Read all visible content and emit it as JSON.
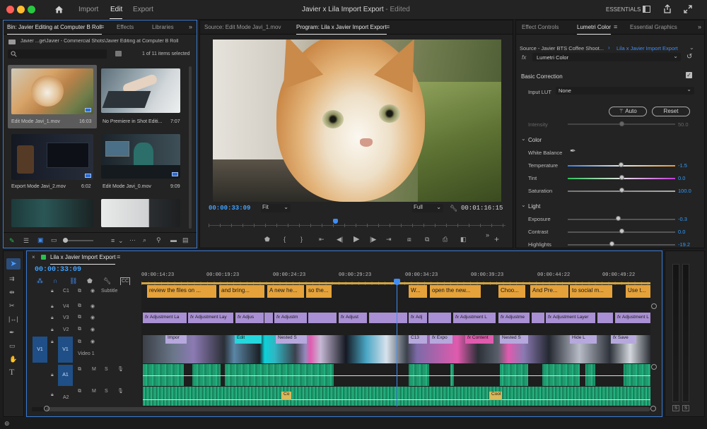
{
  "titlebar": {
    "workspaces": [
      "Import",
      "Edit",
      "Export"
    ],
    "active_workspace": "Edit",
    "project_title": "Javier x Lila Import Export",
    "edited_label": "- Edited",
    "essentials_label": "ESSENTIALS"
  },
  "project_panel": {
    "tabs": [
      "Bin: Javier Editing at Computer B Roll",
      "Effects",
      "Libraries"
    ],
    "path": "Javier ...ge\\Javier - Commercial Shots\\Javier Editing at Computer B Roll",
    "selection_info": "1 of 11 items selected",
    "items": [
      {
        "name": "Edit Mode Javi_1.mov",
        "duration": "16:03"
      },
      {
        "name": "No Premiere in Shot Editi...",
        "duration": "7:07"
      },
      {
        "name": "Export Mode Javi_2.mov",
        "duration": "6:02"
      },
      {
        "name": "Edit Mode Javi_0.mov",
        "duration": "9:09"
      }
    ]
  },
  "monitor": {
    "tabs": [
      "Source: Edit Mode Javi_1.mov",
      "Program: Lila x Javier Import Export"
    ],
    "timecode_current": "00:00:33:09",
    "timecode_duration": "00:01:16:15",
    "zoom": "Fit",
    "resolution": "Full"
  },
  "lumetri": {
    "tabs": [
      "Effect Controls",
      "Lumetri Color",
      "Essential Graphics"
    ],
    "source_label": "Source - Javier BTS Coffee Shoot...",
    "sequence_label": "Lila x Javier Import Export",
    "fx_label": "Lumetri Color",
    "basic_correction": "Basic Correction",
    "input_lut_label": "Input LUT",
    "input_lut_value": "None",
    "auto_label": "Auto",
    "reset_label": "Reset",
    "intensity_label": "Intensity",
    "intensity_value": "50.0",
    "color_section": "Color",
    "white_balance": "White Balance",
    "temperature_label": "Temperature",
    "temperature_value": "-1.5",
    "tint_label": "Tint",
    "tint_value": "0.0",
    "saturation_label": "Saturation",
    "saturation_value": "100.0",
    "light_section": "Light",
    "exposure_label": "Exposure",
    "exposure_value": "-0.3",
    "contrast_label": "Contrast",
    "contrast_value": "0.0",
    "highlights_label": "Highlights",
    "highlights_value": "-19.2"
  },
  "timeline": {
    "title": "Lila x Javier Import Export",
    "timecode": "00:00:33:09",
    "ruler": [
      "00:00:14:23",
      "00:00:19:23",
      "00:00:24:23",
      "00:00:29:23",
      "00:00:34:23",
      "00:00:39:23",
      "00:00:44:22",
      "00:00:49:22"
    ],
    "tracks": {
      "c1": "C1",
      "subtitle": "Subtitle",
      "v4": "V4",
      "v3": "V3",
      "v2": "V2",
      "v1": "V1",
      "video1": "Video 1",
      "a1": "A1",
      "a2": "A2"
    },
    "subtitle_clips": [
      "review the files on ...",
      "and bring...",
      "A new he...",
      "so the...",
      "W...",
      "open the new...",
      "Choo...",
      "And Pre...",
      "to social m...",
      "Use t..."
    ],
    "adjustment_clips": [
      "Adjustment La",
      "Adjustment Lay",
      "Adjus",
      "Adjustm",
      "Adjust",
      "Adj",
      "Adjustment L",
      "Adjustme",
      "Adjustment Layer",
      "Adjustment L"
    ],
    "video_clips": [
      "Impor",
      "Edit",
      "Nested S",
      "C13",
      "Expo",
      "Content",
      "Nested S",
      "Hide L",
      "Save"
    ],
    "audio_clips": [
      "Co",
      "Cool"
    ],
    "accent_playhead": "#3f8df5",
    "accent_subtitle": "#e5a23a",
    "accent_adjustment": "#a98fd3",
    "accent_audio": "#1f9c6f"
  },
  "meter": {
    "solo_labels": [
      "S",
      "S"
    ]
  }
}
